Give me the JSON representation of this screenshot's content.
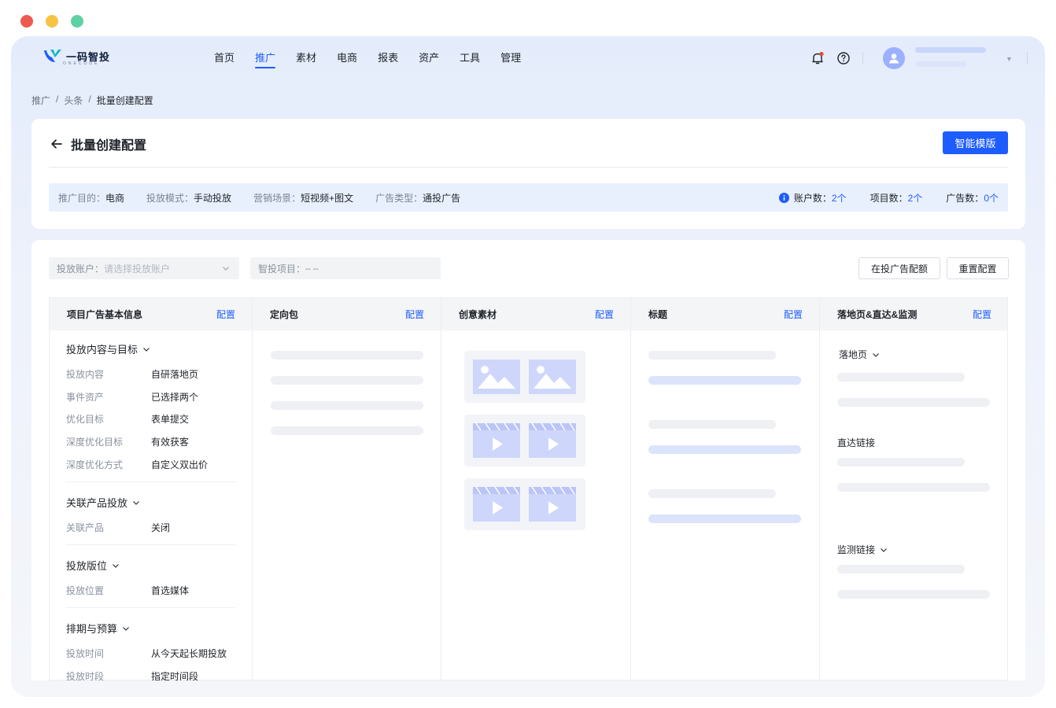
{
  "logo": {
    "text": "一码智投",
    "sub": "ONECODE"
  },
  "nav": {
    "items": [
      "首页",
      "推广",
      "素材",
      "电商",
      "报表",
      "资产",
      "工具",
      "管理"
    ],
    "active_index": 1
  },
  "breadcrumb": {
    "items": [
      "推广",
      "头条",
      "批量创建配置"
    ],
    "separator": "/"
  },
  "header": {
    "title": "批量创建配置",
    "smart_template_label": "智能模版"
  },
  "info": {
    "purpose": {
      "k": "推广目的：",
      "v": "电商"
    },
    "mode": {
      "k": "投放模式：",
      "v": "手动投放"
    },
    "scene": {
      "k": "营销场景：",
      "v": "短视频+图文"
    },
    "adtype": {
      "k": "广告类型：",
      "v": "通投广告"
    },
    "accounts": {
      "k": "账户数：",
      "v": "2个"
    },
    "projects": {
      "k": "项目数：",
      "v": "2个"
    },
    "ads": {
      "k": "广告数：",
      "v": "0个"
    }
  },
  "filters": {
    "account": {
      "k": "投放账户：",
      "placeholder": "请选择投放账户"
    },
    "project": {
      "k": "智投项目：",
      "v": "– –"
    },
    "quota_label": "在投广告配额",
    "reset_label": "重置配置"
  },
  "columns": [
    {
      "title": "项目广告基本信息",
      "action": "配置"
    },
    {
      "title": "定向包",
      "action": "配置"
    },
    {
      "title": "创意素材",
      "action": "配置"
    },
    {
      "title": "标题",
      "action": "配置"
    },
    {
      "title": "落地页&直达&监测",
      "action": "配置"
    }
  ],
  "basic": {
    "sections": [
      {
        "title": "投放内容与目标",
        "rows": [
          {
            "k": "投放内容",
            "v": "自研落地页"
          },
          {
            "k": "事件资产",
            "v": "已选择两个"
          },
          {
            "k": "优化目标",
            "v": "表单提交"
          },
          {
            "k": "深度优化目标",
            "v": "有效获客"
          },
          {
            "k": "深度优化方式",
            "v": "自定义双出价"
          }
        ]
      },
      {
        "title": "关联产品投放",
        "rows": [
          {
            "k": "关联产品",
            "v": "关闭"
          }
        ]
      },
      {
        "title": "投放版位",
        "rows": [
          {
            "k": "投放位置",
            "v": "首选媒体"
          }
        ]
      },
      {
        "title": "排期与预算",
        "rows": [
          {
            "k": "投放时间",
            "v": "从今天起长期投放"
          },
          {
            "k": "投放时段",
            "v": "指定时间段"
          }
        ]
      }
    ]
  },
  "landing": {
    "landing_page": "落地页",
    "direct_link": "直达链接",
    "monitor_link": "监测链接"
  },
  "colors": {
    "accent": "#1d5cff",
    "dot_red": "#ee5a4f",
    "dot_yellow": "#f6c344",
    "dot_green": "#5fd1a5"
  }
}
